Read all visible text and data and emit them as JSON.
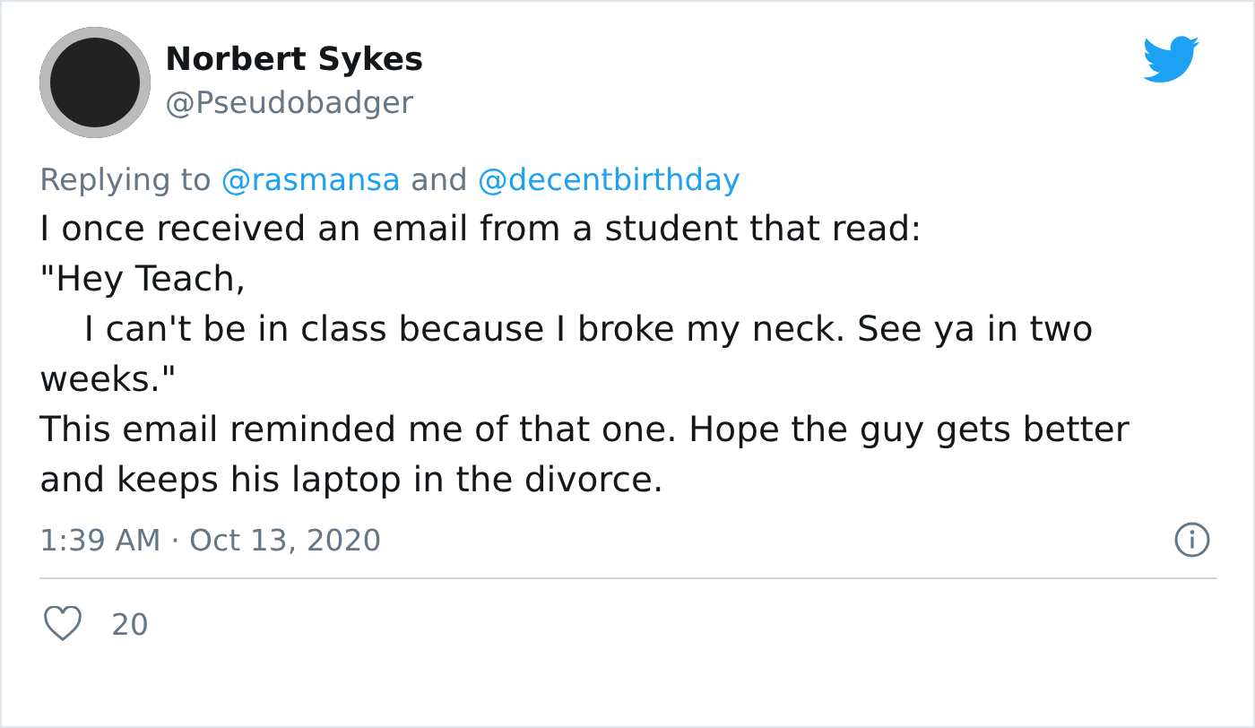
{
  "author": {
    "name": "Norbert Sykes",
    "handle": "@Pseudobadger"
  },
  "reply_to": {
    "label": "Replying to",
    "joiner": "and",
    "mentions": [
      "@rasmansa",
      "@decentbirthday"
    ]
  },
  "text": "I once received an email from a student that read:\n\"Hey Teach,\n    I can't be in class because I broke my neck. See ya in two weeks.\"\nThis email reminded me of that one. Hope the guy gets better and keeps his laptop in the divorce.",
  "timestamp": "1:39 AM · Oct 13, 2020",
  "likes": "20"
}
